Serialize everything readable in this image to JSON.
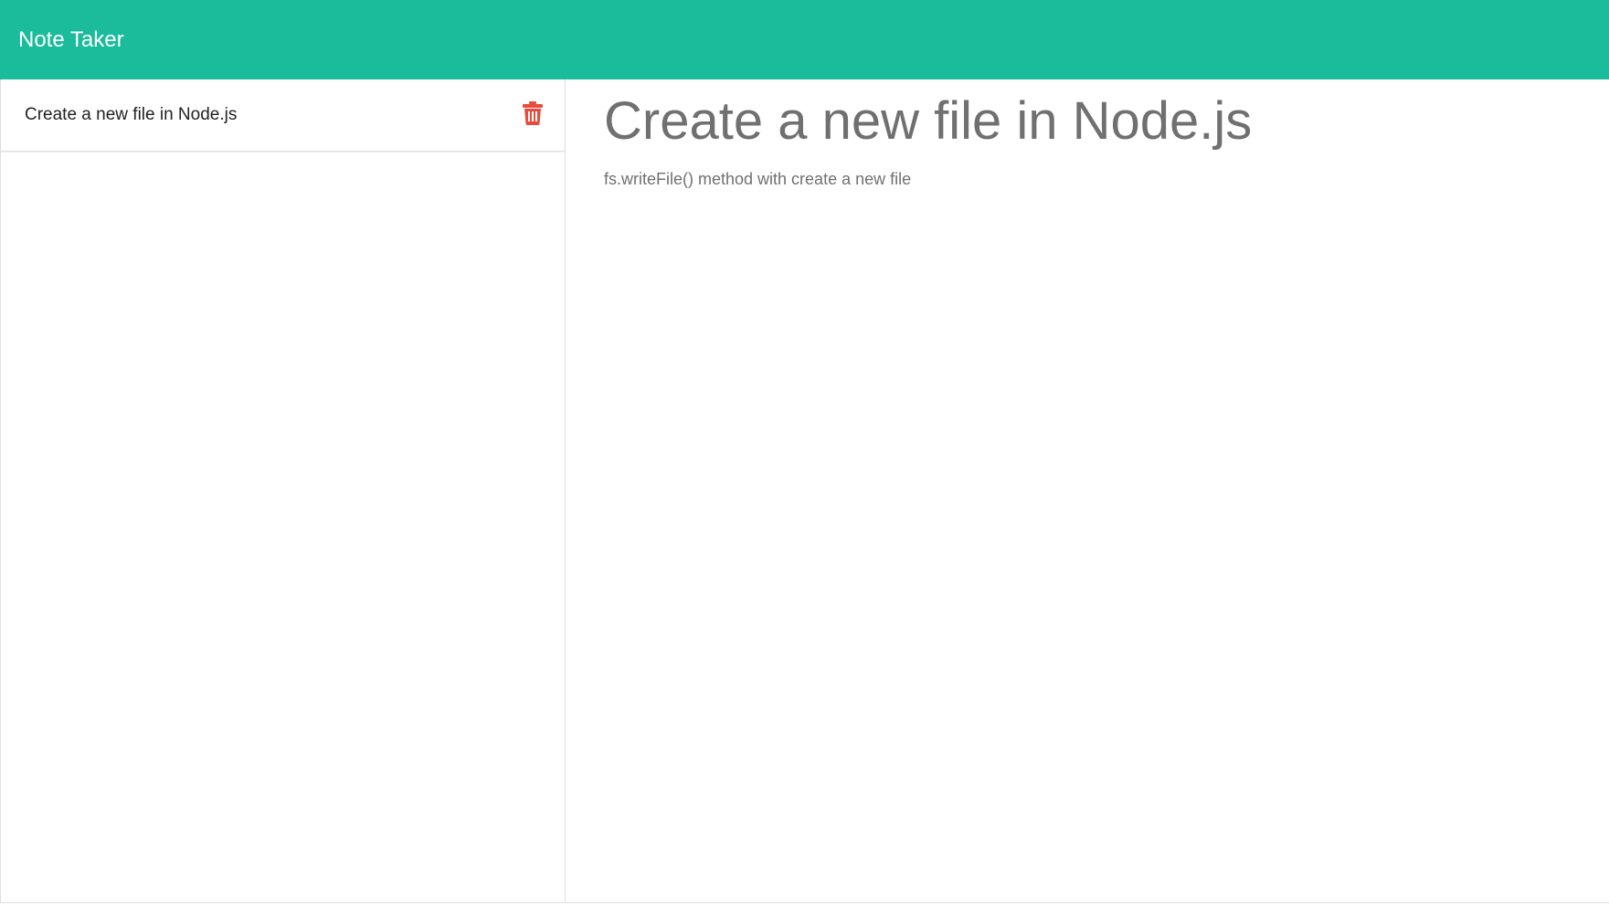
{
  "app": {
    "title": "Note Taker",
    "brand_color": "#1abc9c"
  },
  "sidebar": {
    "notes": [
      {
        "title": "Create a new file in Node.js",
        "delete_icon": "trash-icon",
        "delete_icon_color": "#e74c3c"
      }
    ]
  },
  "active_note": {
    "title": "Create a new file in Node.js",
    "text": "fs.writeFile() method with create a new file",
    "text_color": "#707070"
  }
}
